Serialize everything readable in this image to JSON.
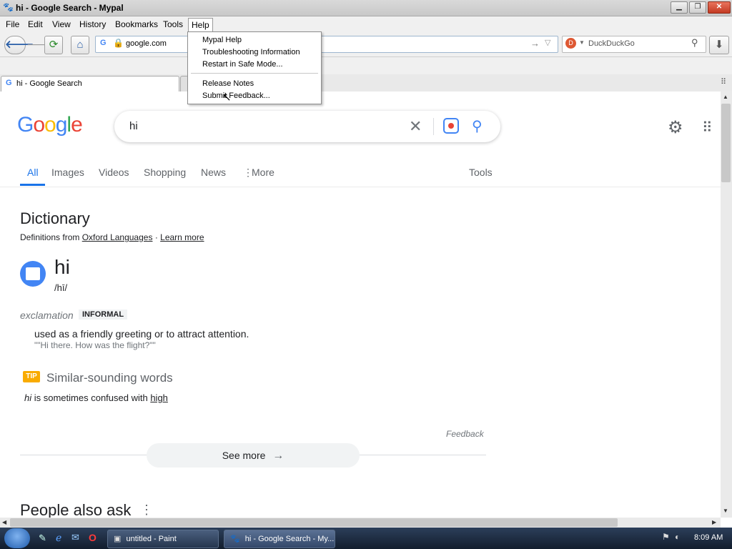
{
  "window": {
    "title": "hi - Google Search - Mypal"
  },
  "menubar": {
    "items": [
      "File",
      "Edit",
      "View",
      "History",
      "Bookmarks",
      "Tools",
      "Help"
    ]
  },
  "navbar": {
    "url": "google.com",
    "search_placeholder": "DuckDuckGo"
  },
  "tabs": [
    {
      "label": "hi - Google Search"
    }
  ],
  "help_menu": {
    "items": [
      "Mypal Help",
      "Troubleshooting Information",
      "Restart in Safe Mode...",
      "Release Notes",
      "Submit Feedback..."
    ]
  },
  "google": {
    "logo": "Google",
    "query": "hi",
    "tabs": [
      "All",
      "Images",
      "Videos",
      "Shopping",
      "News",
      "More"
    ],
    "tools": "Tools"
  },
  "dictionary": {
    "heading": "Dictionary",
    "source_prefix": "Definitions from",
    "source_link": "Oxford Languages",
    "separator": "·",
    "learn_more": "Learn more",
    "word": "hi",
    "pronunciation": "/hī/",
    "pos": "exclamation",
    "register": "INFORMAL",
    "definition": "used as a friendly greeting or to attract attention.",
    "example": "\"\"Hi there. How was the flight?\"\"",
    "tip_badge": "TIP",
    "similar_heading": "Similar-sounding words",
    "confused_word": "hi",
    "confused_text": "is sometimes confused with",
    "confused_link": "high",
    "feedback": "Feedback",
    "see_more": "See more"
  },
  "people_also_ask": "People also ask",
  "taskbar": {
    "items": [
      "untitled - Paint",
      "hi - Google Search - My..."
    ],
    "clock": "8:09 AM"
  },
  "colors": {
    "google_blue": "#1a73e8",
    "taskbar": "#1b2a40",
    "tip_yellow": "#f9ab00"
  }
}
